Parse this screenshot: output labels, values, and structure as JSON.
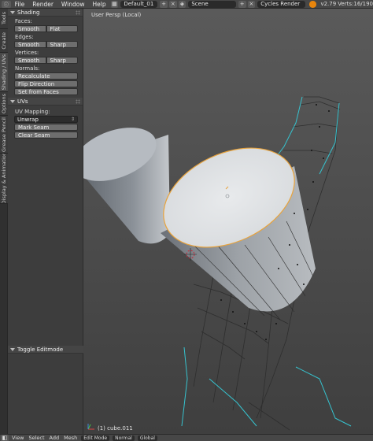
{
  "topbar": {
    "menus": [
      "File",
      "Render",
      "Window",
      "Help"
    ],
    "screen_layout": "Default_01",
    "scene": "Scene",
    "render_engine": "Cycles Render",
    "version": "v2.79",
    "stats": "Verts:16/190"
  },
  "tabs": [
    "Tools",
    "Create",
    "Shading / UVs",
    "Options",
    "Grease Pencil",
    "Display & Animation"
  ],
  "toolshelf": {
    "shading_panel": {
      "title": "Shading",
      "faces_label": "Faces:",
      "faces_buttons": [
        "Smooth",
        "Flat"
      ],
      "edges_label": "Edges:",
      "edges_buttons": [
        "Smooth",
        "Sharp"
      ],
      "vertices_label": "Vertices:",
      "vertices_buttons": [
        "Smooth",
        "Sharp"
      ],
      "normals_label": "Normals:",
      "normals_buttons": [
        "Recalculate",
        "Flip Direction",
        "Set from Faces"
      ]
    },
    "uvs_panel": {
      "title": "UVs",
      "mapping_label": "UV Mapping:",
      "mapping_value": "Unwrap",
      "buttons": [
        "Mark Seam",
        "Clear Seam"
      ]
    },
    "toggle_editmode": "Toggle Editmode"
  },
  "viewport": {
    "view_name": "User Persp (Local)",
    "object_label": "(1) cube.011"
  },
  "bottombar": {
    "items": [
      "View",
      "Select",
      "Add",
      "Mesh",
      "Edit Mode",
      "Normal",
      "Global"
    ]
  },
  "colors": {
    "selection_outline": "#e8a33c",
    "seam_edge": "#36c4d0",
    "background": "#393939"
  }
}
